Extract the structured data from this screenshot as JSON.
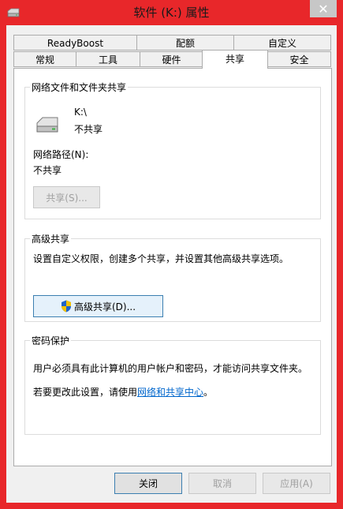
{
  "window": {
    "title": "软件 (K:) 属性",
    "close_glyph": "✕"
  },
  "tabs": {
    "row1": [
      "ReadyBoost",
      "配额",
      "自定义"
    ],
    "row2": [
      "常规",
      "工具",
      "硬件",
      "共享",
      "安全"
    ],
    "active": "共享"
  },
  "network_share": {
    "legend": "网络文件和文件夹共享",
    "drive_name": "K:\\",
    "drive_status": "不共享",
    "path_label": "网络路径(N):",
    "path_value": "不共享",
    "share_button": "共享(S)..."
  },
  "advanced_share": {
    "legend": "高级共享",
    "description": "设置自定义权限，创建多个共享，并设置其他高级共享选项。",
    "button": "高级共享(D)..."
  },
  "password": {
    "legend": "密码保护",
    "text1": "用户必须具有此计算机的用户帐户和密码，才能访问共享文件夹。",
    "text2_prefix": "若要更改此设置，请使用",
    "text2_link": "网络和共享中心",
    "text2_suffix": "。"
  },
  "footer": {
    "ok": "关闭",
    "cancel": "取消",
    "apply": "应用(A)"
  }
}
